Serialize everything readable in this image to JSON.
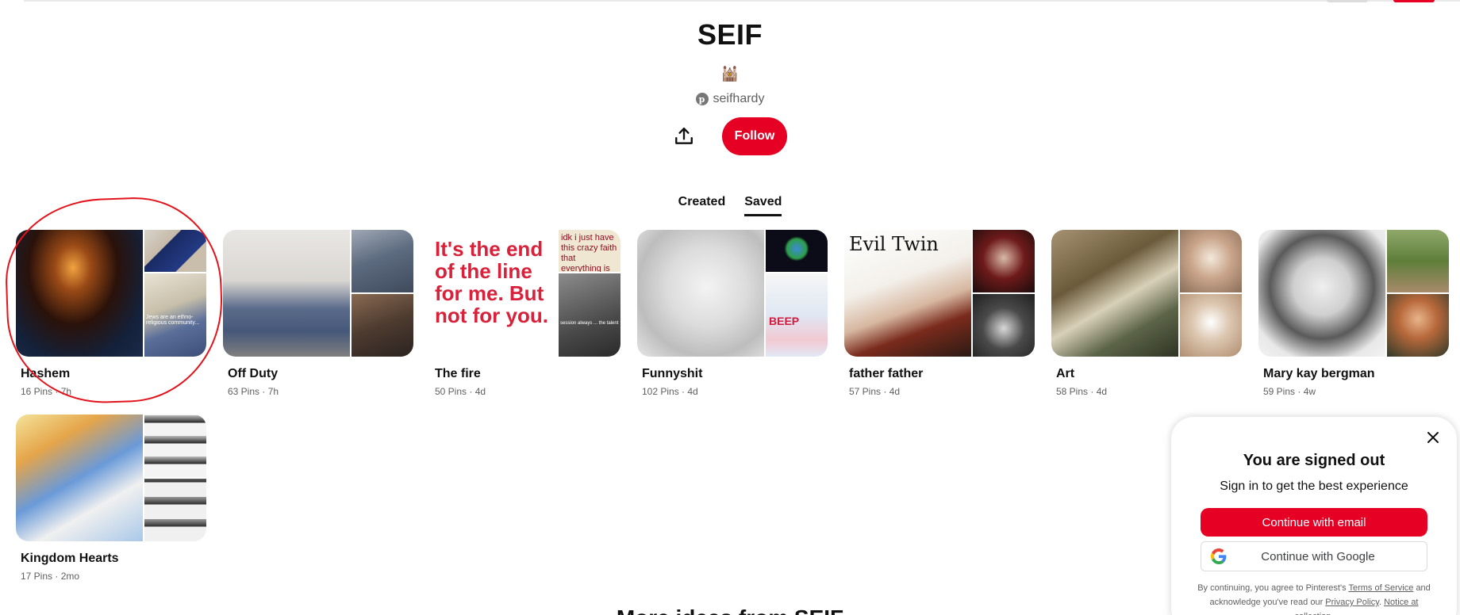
{
  "profile": {
    "name": "SEIF",
    "emoji": "🕍",
    "handle": "seifhardy",
    "follow_label": "Follow"
  },
  "tabs": [
    {
      "label": "Created",
      "active": false
    },
    {
      "label": "Saved",
      "active": true
    }
  ],
  "boards": [
    {
      "title": "Hashem",
      "meta": "16 Pins · 7h"
    },
    {
      "title": "Off Duty",
      "meta": "63 Pins · 7h"
    },
    {
      "title": "The fire",
      "meta": "50 Pins · 4d"
    },
    {
      "title": "Funnyshit",
      "meta": "102 Pins · 4d"
    },
    {
      "title": "father father",
      "meta": "57 Pins · 4d"
    },
    {
      "title": "Art",
      "meta": "58 Pins · 4d"
    },
    {
      "title": "Mary kay bergman",
      "meta": "59 Pins · 4w"
    },
    {
      "title": "Kingdom Hearts",
      "meta": "17 Pins · 2mo"
    }
  ],
  "cover_thumbnails": [
    {
      "main_text": "",
      "side_top_text": "",
      "side_bottom_text": "Jews are an ethno-religious community..."
    },
    {
      "main_text": "",
      "side_top_text": "",
      "side_bottom_text": ""
    },
    {
      "main_text": "It's the end of the line for me. But not for you.",
      "side_top_text": "idk i just have this crazy faith that everything is gonna work out for me",
      "side_bottom_text": "session always ... the talent"
    },
    {
      "main_text": "",
      "side_top_text": "",
      "side_bottom_text": "BEEP"
    },
    {
      "main_text": "Evil Twin",
      "side_top_text": "",
      "side_bottom_text": ""
    },
    {
      "main_text": "",
      "side_top_text": "",
      "side_bottom_text": ""
    },
    {
      "main_text": "",
      "side_top_text": "",
      "side_bottom_text": ""
    },
    {
      "main_text": "",
      "side_top_text": "",
      "side_bottom_text": ""
    }
  ],
  "bottom_heading": "More ideas from SEIF",
  "signin_modal": {
    "title": "You are signed out",
    "subtitle": "Sign in to get the best experience",
    "email_button": "Continue with email",
    "google_button": "Continue with Google",
    "legal_prefix": "By continuing, you agree to Pinterest's",
    "terms_link": "Terms of Service",
    "legal_middle": "and acknowledge you've read our",
    "privacy_link": "Privacy Policy",
    "notice_link": "Notice at collection",
    "legal_suffix": "."
  },
  "colors": {
    "brand_red": "#e60023",
    "annotation_red": "#e3131b",
    "muted_text": "#5f5f5f"
  },
  "icons": {
    "share": "share-icon",
    "close": "close-icon",
    "pinterest": "pinterest-logo-icon",
    "google": "google-logo-icon"
  }
}
